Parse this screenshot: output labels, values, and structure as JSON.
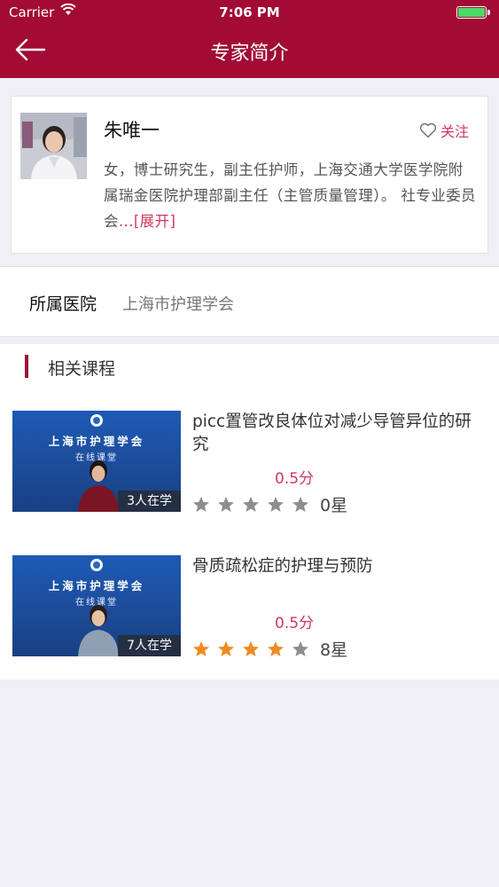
{
  "status_bar": {
    "carrier": "Carrier",
    "time": "7:06 PM"
  },
  "nav": {
    "title": "专家简介"
  },
  "expert": {
    "name": "朱唯一",
    "follow_label": "关注",
    "bio": "女，博士研究生，副主任护师，上海交通大学医学院附属瑞金医院护理部副主任（主管质量管理）。 社专业委员会",
    "expand_label": "...[展开]"
  },
  "hospital": {
    "label": "所属医院",
    "value": "上海市护理学会"
  },
  "courses_section": {
    "title": "相关课程",
    "items": [
      {
        "title": "picc置管改良体位对减少导管异位的研究",
        "score": "0.5分",
        "studying": "3人在学",
        "thumb_org": "上海市护理学会",
        "thumb_sub": "在线课堂",
        "rating": 0,
        "rating_label": "0星"
      },
      {
        "title": "骨质疏松症的护理与预防",
        "score": "0.5分",
        "studying": "7人在学",
        "thumb_org": "上海市护理学会",
        "thumb_sub": "在线课堂",
        "rating": 4,
        "rating_label": "8星"
      }
    ]
  },
  "colors": {
    "brand": "#a20b34",
    "accent": "#d0385f",
    "star_on": "#f08a24",
    "star_off": "#8e8e8e"
  }
}
